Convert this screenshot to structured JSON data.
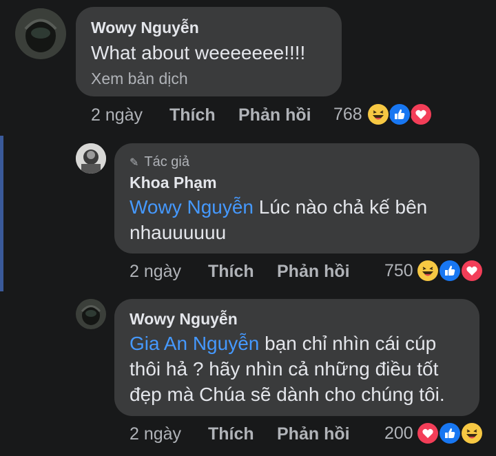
{
  "comments": [
    {
      "name": "Wowy Nguyễn",
      "text": "What about weeeeeee!!!!",
      "translate": "Xem bản dịch",
      "actions": {
        "time": "2 ngày",
        "like": "Thích",
        "reply": "Phản hồi"
      },
      "reaction_count": "768",
      "reactions": [
        "haha",
        "like",
        "love"
      ]
    },
    {
      "author_tag": "Tác giả",
      "name": "Khoa Phạm",
      "mention": "Wowy Nguyễn",
      "text_line1": "Lúc nào chả kế bên",
      "text_line2": "nhauuuuuu",
      "actions": {
        "time": "2 ngày",
        "like": "Thích",
        "reply": "Phản hồi"
      },
      "reaction_count": "750",
      "reactions": [
        "haha",
        "like",
        "love"
      ]
    },
    {
      "name": "Wowy Nguyễn",
      "mention": "Gia An Nguyễn",
      "text_line1": "bạn chỉ nhìn cái cúp",
      "text_line2": "thôi hả ? hãy nhìn cả những điều tốt",
      "text_line3": "đẹp mà Chúa sẽ dành cho chúng tôi.",
      "actions": {
        "time": "2 ngày",
        "like": "Thích",
        "reply": "Phản hồi"
      },
      "reaction_count": "200",
      "reactions": [
        "love",
        "like",
        "haha"
      ]
    }
  ],
  "colors": {
    "background": "#18191a",
    "bubble": "#3a3b3c",
    "mention": "#4599ff",
    "muted": "#b0b3b8",
    "thread_line": "#3a5a9a"
  }
}
